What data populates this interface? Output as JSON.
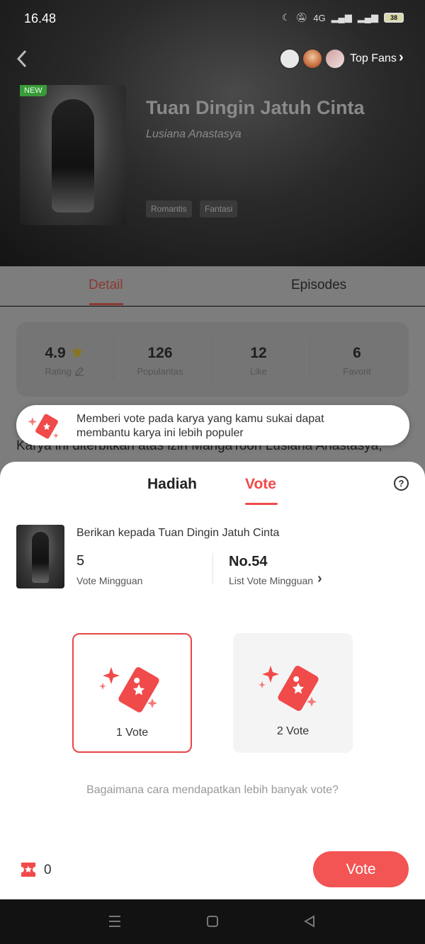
{
  "status_bar": {
    "time": "16.48",
    "network": "4G",
    "battery": "38"
  },
  "header": {
    "top_fans_label": "Top Fans"
  },
  "book": {
    "badge": "NEW",
    "title": "Tuan Dingin Jatuh Cinta",
    "author": "Lusiana Anastasya",
    "genres": [
      "Romantis",
      "Fantasi"
    ]
  },
  "tabs": {
    "detail": "Detail",
    "episodes": "Episodes"
  },
  "stats": [
    {
      "value": "4.9",
      "label": "Rating"
    },
    {
      "value": "126",
      "label": "Popularitas"
    },
    {
      "value": "12",
      "label": "Like"
    },
    {
      "value": "6",
      "label": "Favorit"
    }
  ],
  "description": "Karya ini diterbitkan atas izin MangaToon Lusiana Anastasya,",
  "tooltip": {
    "line1": "Memberi vote pada karya yang kamu sukai dapat",
    "line2": "membantu karya ini lebih populer"
  },
  "sheet": {
    "tab_gift": "Hadiah",
    "tab_vote": "Vote",
    "help": "?",
    "give_to": "Berikan kepada Tuan Dingin Jatuh Cinta",
    "weekly_votes_value": "5",
    "weekly_votes_label": "Vote Mingguan",
    "rank_value": "No.54",
    "rank_label": "List Vote Mingguan",
    "options": [
      {
        "label": "1 Vote",
        "selected": true
      },
      {
        "label": "2 Vote",
        "selected": false
      }
    ],
    "how_more": "Bagaimana cara mendapatkan lebih banyak vote?",
    "ticket_count": "0",
    "vote_button": "Vote"
  },
  "colors": {
    "accent": "#f04a4a",
    "button": "#f35454",
    "badge": "#3a9a3a"
  },
  "icons": [
    "back-icon",
    "chevron-right-icon",
    "star-icon",
    "edit-icon",
    "help-icon",
    "ticket-icon",
    "menu-icon",
    "home-icon",
    "back-triangle-icon"
  ]
}
